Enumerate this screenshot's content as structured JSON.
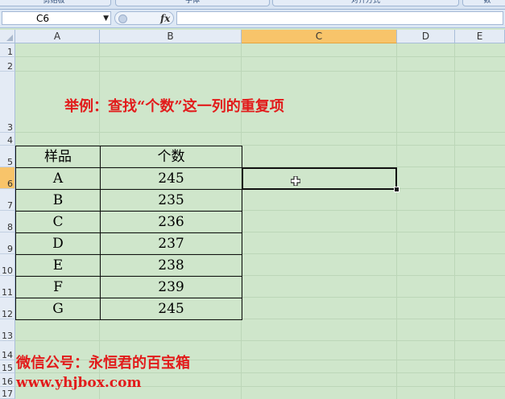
{
  "ribbon": {
    "tabs": [
      "剪贴板",
      "字体",
      "对齐方式",
      "数"
    ]
  },
  "formula_bar": {
    "name_box": "C6",
    "fx_label": "fx",
    "formula": ""
  },
  "columns": [
    "A",
    "B",
    "C",
    "D",
    "E"
  ],
  "selected_column": "C",
  "rows": [
    "1",
    "2",
    "3",
    "4",
    "5",
    "6",
    "7",
    "8",
    "9",
    "10",
    "11",
    "12",
    "13",
    "14",
    "15",
    "16",
    "17"
  ],
  "selected_row": "6",
  "sheet": {
    "heading": "举例：查找“个数”这一列的重复项",
    "table": {
      "headers": [
        "样品",
        "个数"
      ],
      "rows": [
        [
          "A",
          "245"
        ],
        [
          "B",
          "235"
        ],
        [
          "C",
          "236"
        ],
        [
          "D",
          "237"
        ],
        [
          "E",
          "238"
        ],
        [
          "F",
          "239"
        ],
        [
          "G",
          "245"
        ]
      ]
    },
    "footer_line1": "微信公号：永恒君的百宝箱",
    "footer_line2": "www.yhjbox.com"
  },
  "colors": {
    "sheet_bg": "#cfe6cb",
    "accent_red": "#e21b1b",
    "selected_header": "#f8c46a"
  }
}
